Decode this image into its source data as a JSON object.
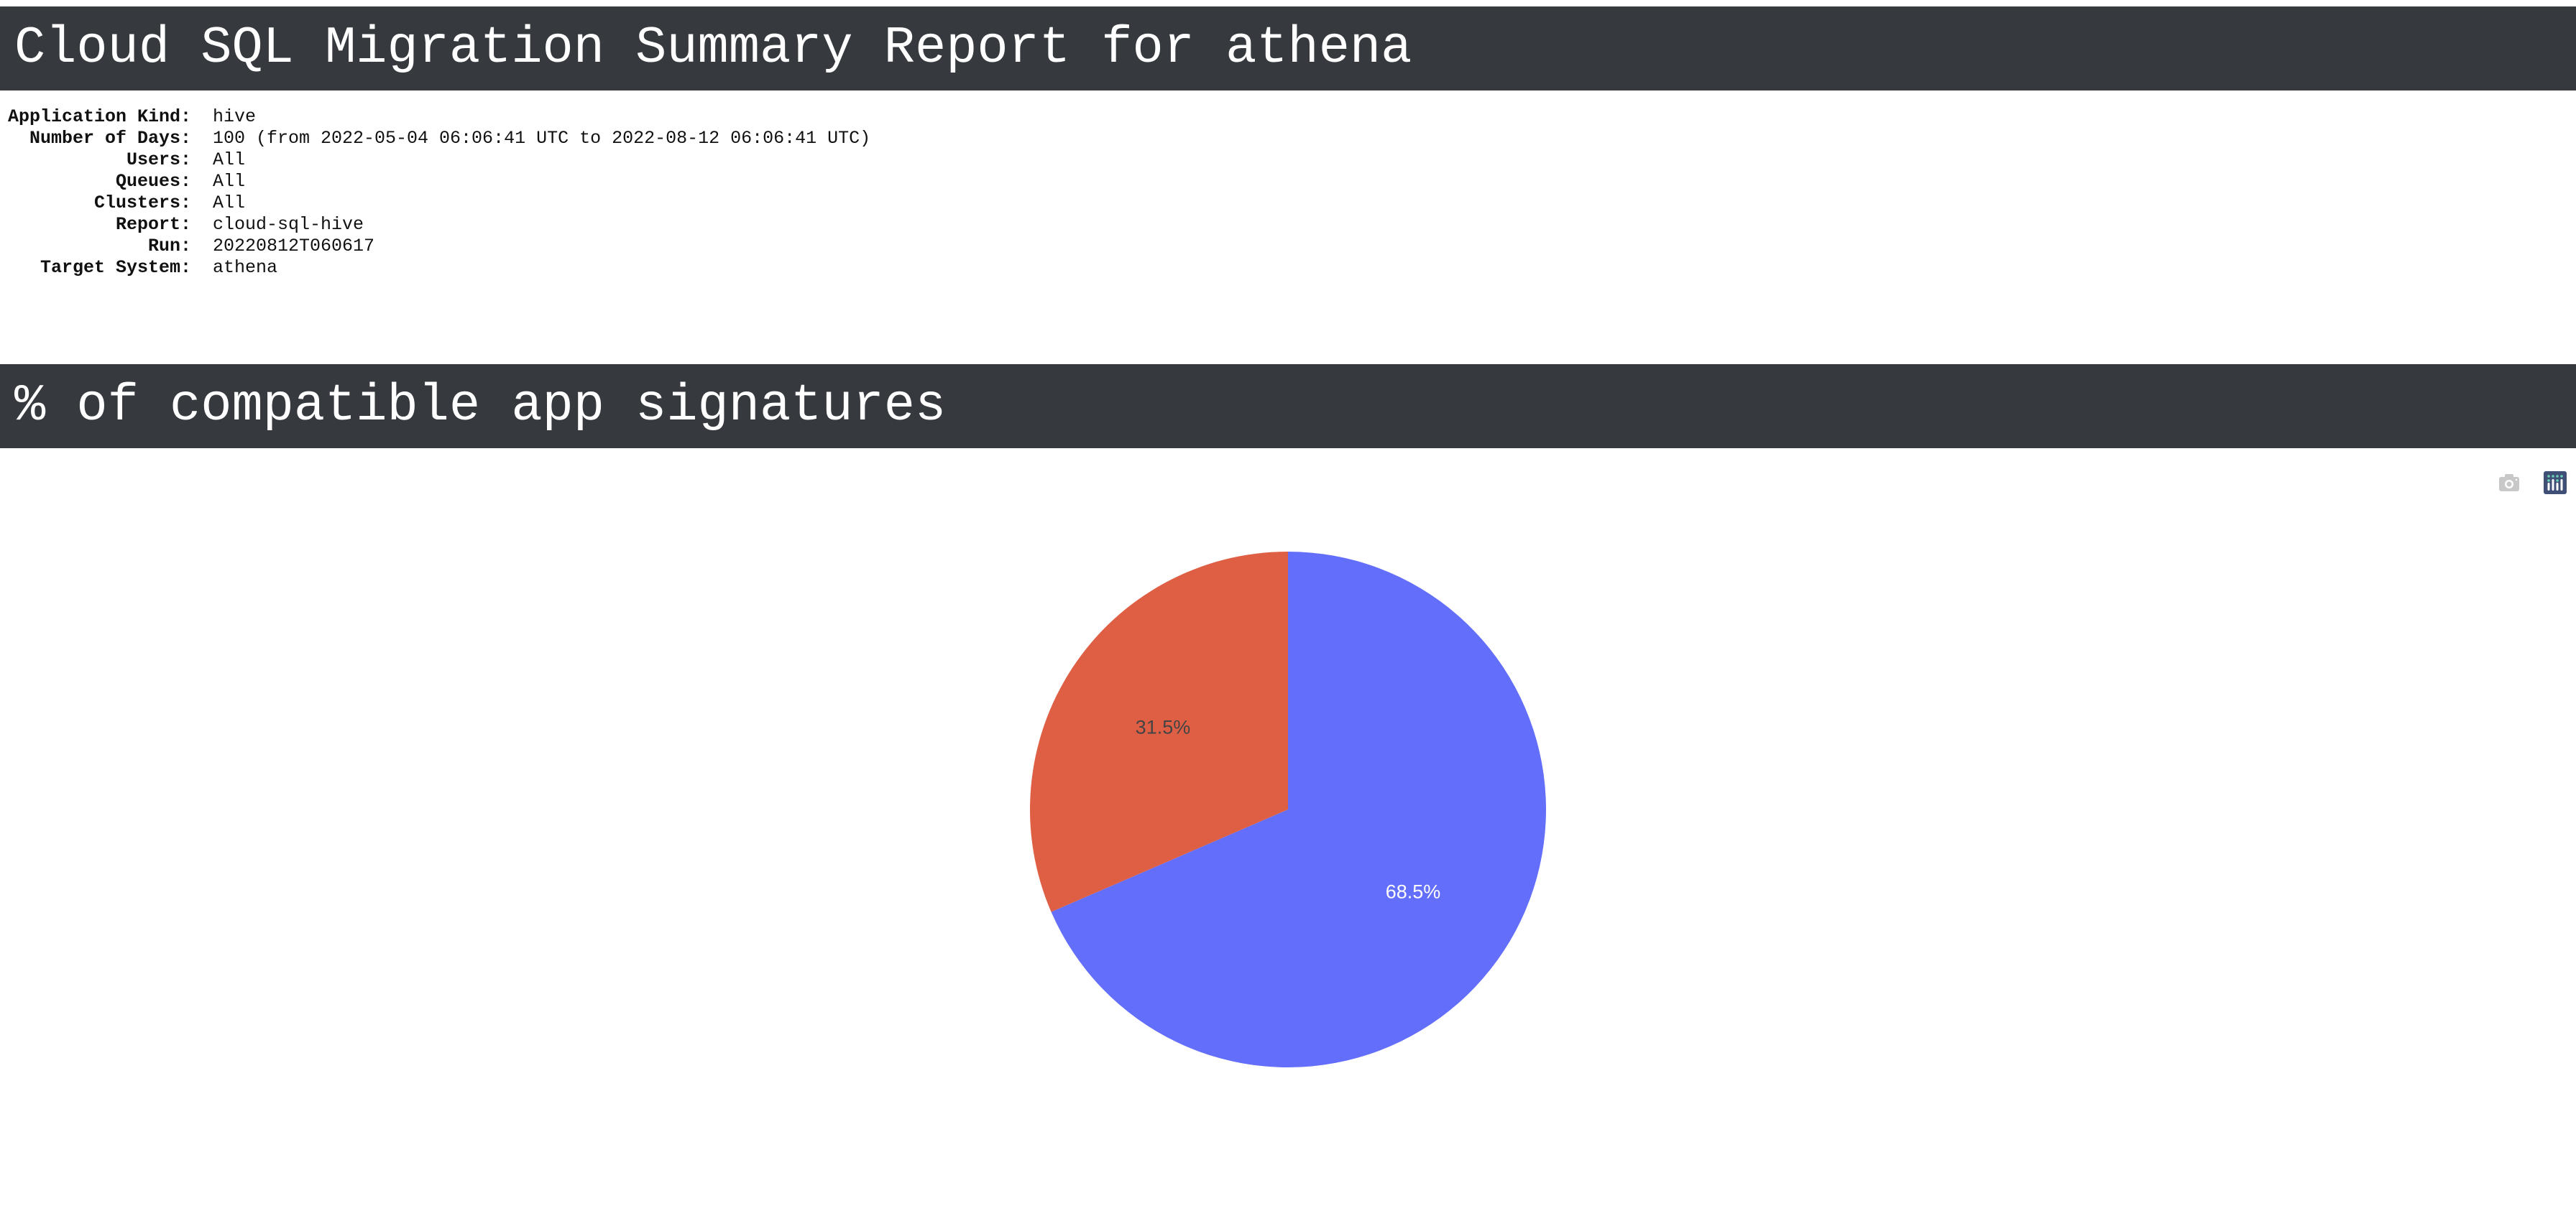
{
  "header": {
    "title": "Cloud SQL Migration Summary Report for athena"
  },
  "info": [
    {
      "label": "Application Kind:",
      "value": "hive"
    },
    {
      "label": "Number of Days:",
      "value": "100 (from 2022-05-04 06:06:41 UTC to 2022-08-12 06:06:41 UTC)"
    },
    {
      "label": "Users:",
      "value": "All"
    },
    {
      "label": "Queues:",
      "value": "All"
    },
    {
      "label": "Clusters:",
      "value": "All"
    },
    {
      "label": "Report:",
      "value": "cloud-sql-hive"
    },
    {
      "label": "Run:",
      "value": "20220812T060617"
    },
    {
      "label": "Target System:",
      "value": "athena"
    }
  ],
  "section": {
    "title": "% of compatible app signatures"
  },
  "toolbar": {
    "icons": [
      "camera-icon",
      "plotly-logo-icon"
    ]
  },
  "chart_data": {
    "type": "pie",
    "values": [
      68.5,
      31.5
    ],
    "labels": [
      "68.5%",
      "31.5%"
    ],
    "colors": [
      "#636efa",
      "#df5f45"
    ],
    "text_colors": [
      "#ffffff",
      "#444444"
    ],
    "direction": "clockwise",
    "start": "top"
  }
}
